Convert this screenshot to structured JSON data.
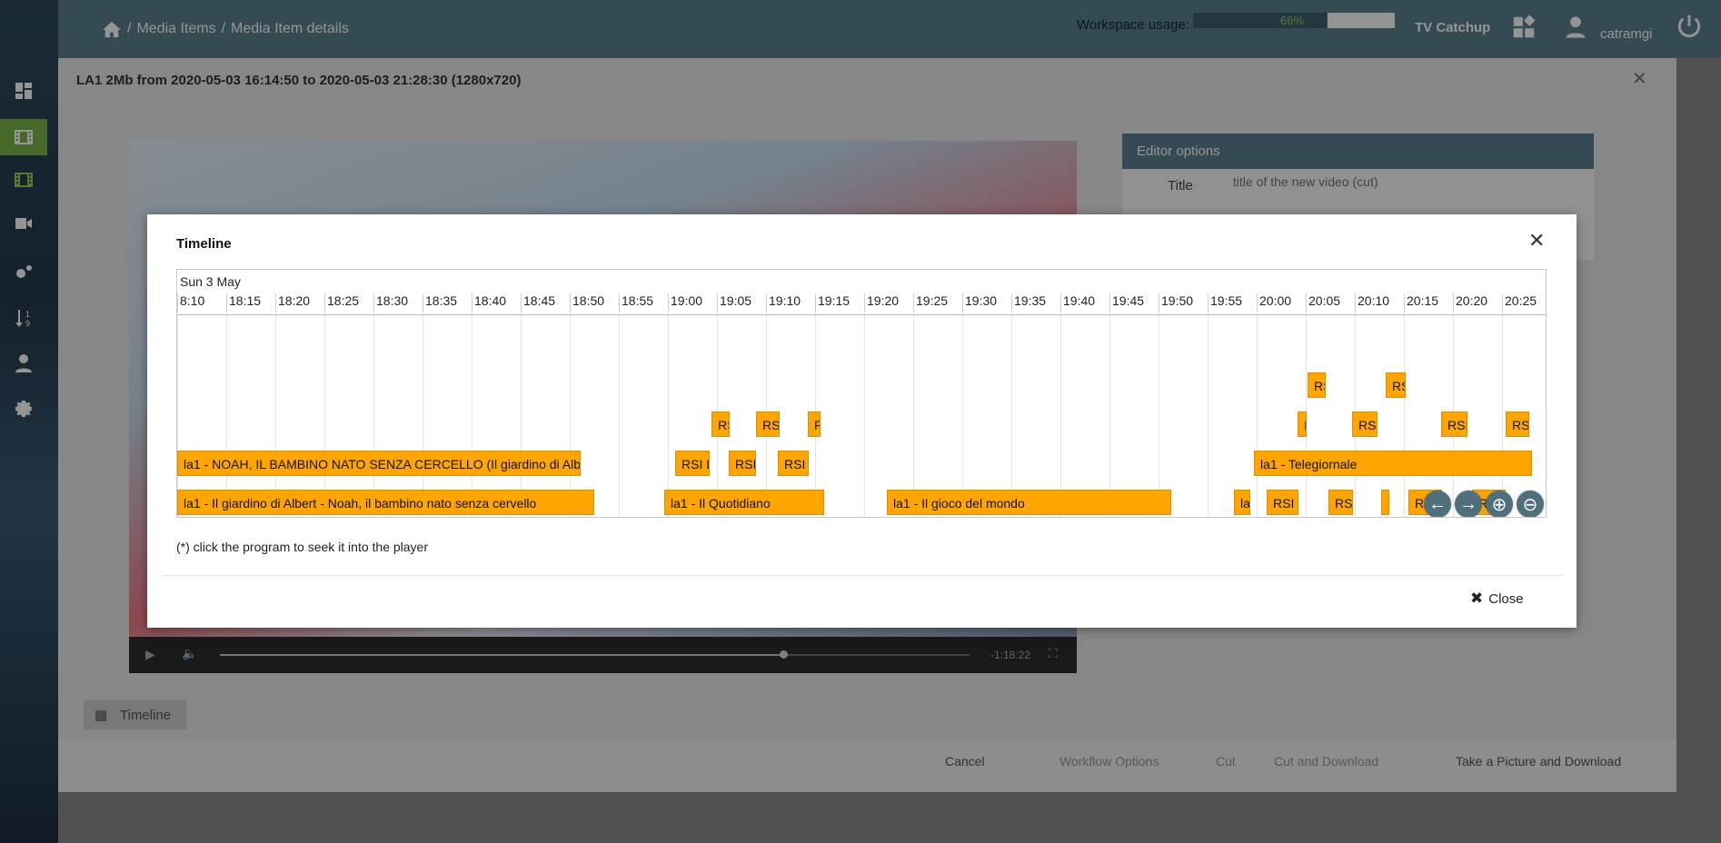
{
  "header": {
    "breadcrumb": [
      "/",
      "Media Items",
      "/",
      "Media Item details"
    ],
    "workspace_label": "Workspace usage:",
    "workspace_percent": "66%",
    "workspace_fraction": 0.66,
    "brand": "TV Catchup",
    "user": "catramgi"
  },
  "sidebar": {
    "items": [
      {
        "icon": "dashboard-icon"
      },
      {
        "icon": "film-icon",
        "active": true
      },
      {
        "icon": "film-icon"
      },
      {
        "icon": "video-camera-icon"
      },
      {
        "icon": "gears-icon"
      },
      {
        "icon": "sort-numeric-icon"
      },
      {
        "icon": "user-icon"
      },
      {
        "icon": "settings-icon"
      }
    ]
  },
  "background_page": {
    "title": "LA1 2Mb from 2020-05-03 16:14:50 to 2020-05-03 21:28:30 (1280x720)",
    "editor_options": "Editor options",
    "title_label": "Title",
    "title_placeholder": "title of the new video (cut)",
    "video_time": "-1:18:22",
    "timeline_button": "Timeline",
    "footer_buttons": [
      "Cancel",
      "Workflow Options",
      "Cut",
      "Cut and Download",
      "Take a Picture and Download"
    ]
  },
  "modal": {
    "title": "Timeline",
    "date_label": "Sun 3 May",
    "ticks": [
      "8:10",
      "18:15",
      "18:20",
      "18:25",
      "18:30",
      "18:35",
      "18:40",
      "18:45",
      "18:50",
      "18:55",
      "19:00",
      "19:05",
      "19:10",
      "19:15",
      "19:20",
      "19:25",
      "19:30",
      "19:35",
      "19:40",
      "19:45",
      "19:50",
      "19:55",
      "20:00",
      "20:05",
      "20:10",
      "20:15",
      "20:20",
      "20:25"
    ],
    "items": [
      {
        "label": "RS",
        "row": 0,
        "start": "20:05"
      },
      {
        "label": "RS",
        "row": 0,
        "start": "20:13"
      },
      {
        "label": "RS",
        "row": 1,
        "start": "19:05"
      },
      {
        "label": "RS",
        "row": 1,
        "start": "19:09"
      },
      {
        "label": "R",
        "row": 1,
        "start": "19:15"
      },
      {
        "label": "I",
        "row": 1,
        "start": "20:03"
      },
      {
        "label": "RSI",
        "row": 1,
        "start": "20:09"
      },
      {
        "label": "RSI",
        "row": 1,
        "start": "20:18"
      },
      {
        "label": "RS",
        "row": 1,
        "start": "20:24"
      },
      {
        "label": "la1 - NOAH, IL BAMBINO NATO SENZA CERCELLO (Il giardino di Albert)",
        "row": 2,
        "start": "18:10"
      },
      {
        "label": "RSI L",
        "row": 2,
        "start": "18:59"
      },
      {
        "label": "RSI",
        "row": 2,
        "start": "19:04"
      },
      {
        "label": "RSI",
        "row": 2,
        "start": "19:10"
      },
      {
        "label": "la1 - Telegiornale",
        "row": 2,
        "start": "20:00"
      },
      {
        "label": "la1 - Il giardino di Albert - Noah, il bambino nato senza cervello",
        "row": 3,
        "start": "18:10"
      },
      {
        "label": "la1 - Il Quotidiano",
        "row": 3,
        "start": "19:00"
      },
      {
        "label": "la1 - Il gioco del mondo",
        "row": 3,
        "start": "19:21"
      },
      {
        "label": "la",
        "row": 3,
        "start": "19:58"
      },
      {
        "label": "RSI",
        "row": 3,
        "start": "20:01"
      },
      {
        "label": "RS",
        "row": 3,
        "start": "20:07"
      },
      {
        "label": "",
        "row": 3,
        "start": "20:12"
      },
      {
        "label": "RSI I",
        "row": 3,
        "start": "20:15"
      },
      {
        "label": "RSI I",
        "row": 3,
        "start": "20:21"
      }
    ],
    "note": "(*) click the program to seek it into the player",
    "close_label": "Close"
  }
}
